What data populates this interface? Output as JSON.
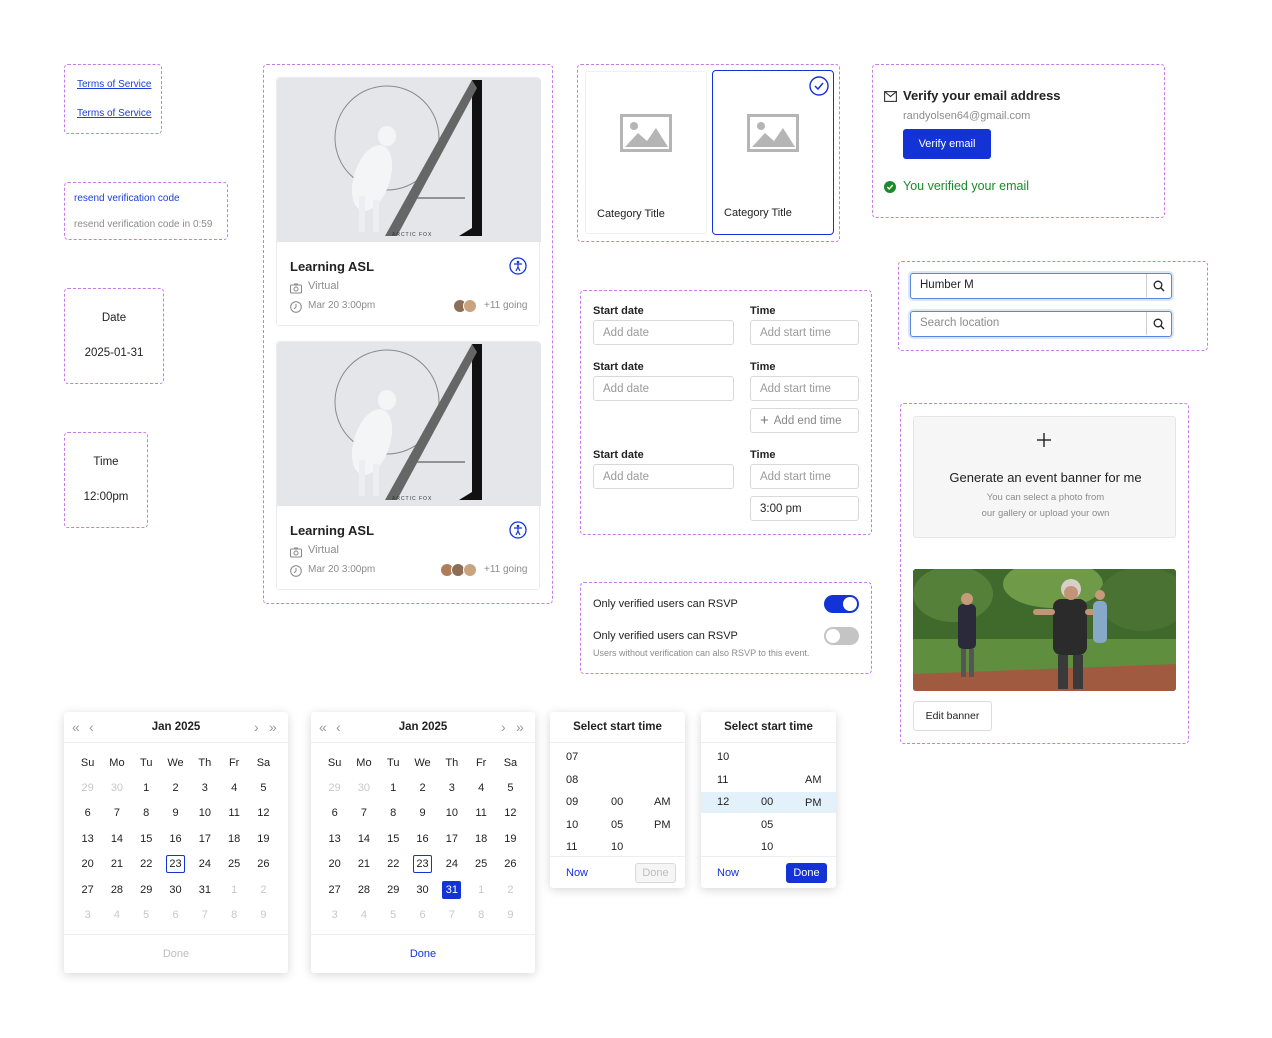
{
  "terms": {
    "link1": "Terms of Service",
    "link2": "Terms of Service"
  },
  "resend": {
    "link": "resend verification code",
    "countdown": "resend verification code in 0:59"
  },
  "date_display": {
    "label": "Date",
    "value": "2025-01-31"
  },
  "time_display": {
    "label": "Time",
    "value": "12:00pm"
  },
  "event_cards": [
    {
      "image_caption": "ARCTIC FOX",
      "title": "Learning ASL",
      "location": "Virtual",
      "datetime": "Mar 20 3:00pm",
      "going": "+11 going"
    },
    {
      "image_caption": "ARCTIC FOX",
      "title": "Learning ASL",
      "location": "Virtual",
      "datetime": "Mar 20 3:00pm",
      "going": "+11 going"
    }
  ],
  "categories": [
    {
      "title": "Category Title",
      "selected": false
    },
    {
      "title": "Category Title",
      "selected": true
    }
  ],
  "verify": {
    "title": "Verify your email address",
    "email": "randyolsen64@gmail.com",
    "button": "Verify email",
    "success": "You verified your email"
  },
  "search": {
    "field1_value": "Humber M",
    "field2_placeholder": "Search location"
  },
  "schedule": {
    "row1": {
      "date_label": "Start date",
      "date_placeholder": "Add date",
      "time_label": "Time",
      "time_placeholder": "Add start time"
    },
    "row2": {
      "date_label": "Start date",
      "date_placeholder": "Add date",
      "time_label": "Time",
      "time_placeholder": "Add start time",
      "end_button": "Add end time"
    },
    "row3": {
      "date_label": "Start date",
      "date_placeholder": "Add date",
      "time_label": "Time",
      "time_placeholder": "Add start time",
      "end_value": "3:00 pm"
    }
  },
  "rsvp": {
    "toggle1": {
      "label": "Only verified users can RSVP",
      "on": true
    },
    "toggle2": {
      "label": "Only verified users can RSVP",
      "on": false,
      "help": "Users without verification can also RSVP to this event."
    }
  },
  "banner": {
    "generate_title": "Generate an event banner for me",
    "generate_help1": "You can select a photo from",
    "generate_help2": "our gallery or upload your own",
    "edit_button": "Edit banner"
  },
  "calendar1": {
    "month": "Jan 2025",
    "weekdays": [
      "Su",
      "Mo",
      "Tu",
      "We",
      "Th",
      "Fr",
      "Sa"
    ],
    "days": [
      "29",
      "30",
      "1",
      "2",
      "3",
      "4",
      "5",
      "6",
      "7",
      "8",
      "9",
      "10",
      "11",
      "12",
      "13",
      "14",
      "15",
      "16",
      "17",
      "18",
      "19",
      "20",
      "21",
      "22",
      "23",
      "24",
      "25",
      "26",
      "27",
      "28",
      "29",
      "30",
      "31",
      "1",
      "2",
      "3",
      "4",
      "5",
      "6",
      "7",
      "8",
      "9"
    ],
    "today": "23",
    "selected": null,
    "done": "Done"
  },
  "calendar2": {
    "month": "Jan 2025",
    "weekdays": [
      "Su",
      "Mo",
      "Tu",
      "We",
      "Th",
      "Fr",
      "Sa"
    ],
    "days": [
      "29",
      "30",
      "1",
      "2",
      "3",
      "4",
      "5",
      "6",
      "7",
      "8",
      "9",
      "10",
      "11",
      "12",
      "13",
      "14",
      "15",
      "16",
      "17",
      "18",
      "19",
      "20",
      "21",
      "22",
      "23",
      "24",
      "25",
      "26",
      "27",
      "28",
      "29",
      "30",
      "31",
      "1",
      "2",
      "3",
      "4",
      "5",
      "6",
      "7",
      "8",
      "9"
    ],
    "today": "23",
    "selected": "31",
    "done": "Done"
  },
  "timepicker1": {
    "title": "Select start time",
    "hours": [
      "07",
      "08",
      "09",
      "10",
      "11"
    ],
    "minutes": [
      "00",
      "05",
      "10"
    ],
    "periods": [
      "AM",
      "PM"
    ],
    "now": "Now",
    "done": "Done"
  },
  "timepicker2": {
    "title": "Select start time",
    "hours": [
      "10",
      "11",
      "12"
    ],
    "minutes": [
      "00",
      "05",
      "10"
    ],
    "periods": [
      "AM",
      "PM"
    ],
    "now": "Now",
    "done": "Done"
  },
  "colors": {
    "accent": "#1333d6",
    "success": "#1a8a2a",
    "dashed": "#c77be6",
    "selected_bg": "#e3f1fb"
  }
}
